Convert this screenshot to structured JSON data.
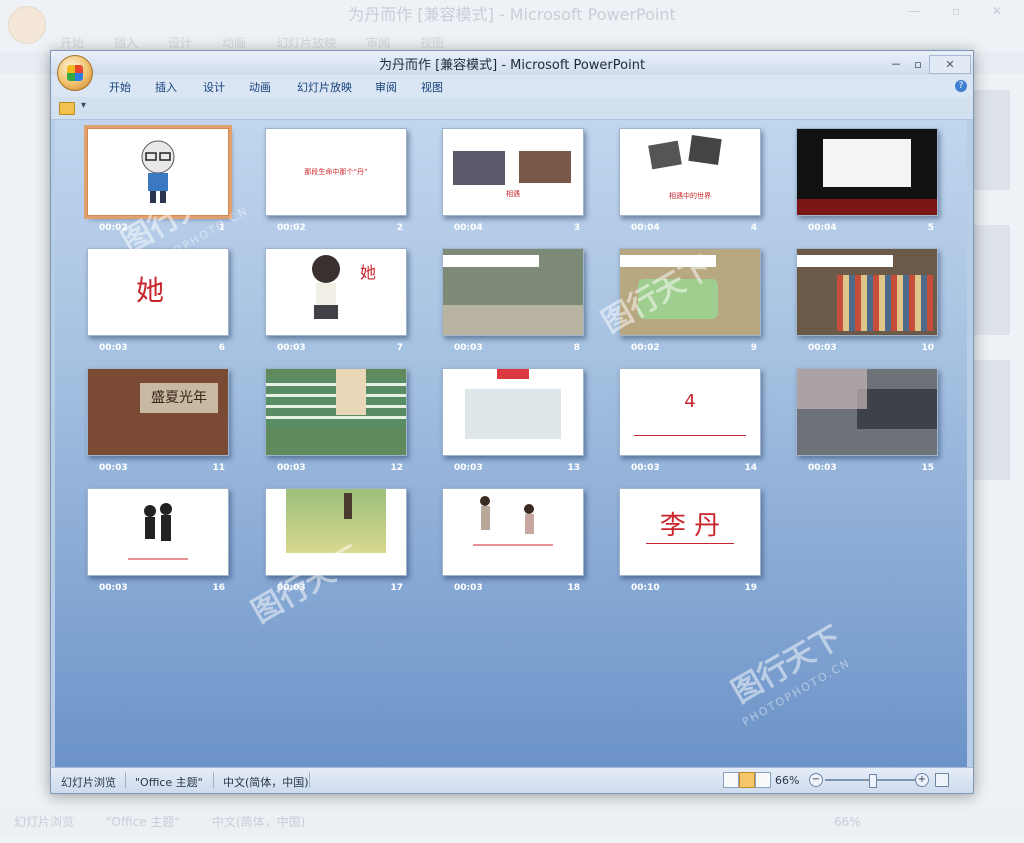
{
  "window": {
    "title": "为丹而作 [兼容模式] - Microsoft PowerPoint",
    "controls": [
      "－",
      "▫",
      "✕"
    ]
  },
  "tabs": [
    "开始",
    "插入",
    "设计",
    "动画",
    "幻灯片放映",
    "审阅",
    "视图"
  ],
  "slides": [
    {
      "number": "1",
      "time": "00:02",
      "text": "",
      "selected": true
    },
    {
      "number": "2",
      "time": "00:02",
      "text": "那段生命中那个“丹”",
      "selected": false
    },
    {
      "number": "3",
      "time": "00:04",
      "text": "相遇",
      "selected": false
    },
    {
      "number": "4",
      "time": "00:04",
      "text": "相遇中的世界",
      "selected": false
    },
    {
      "number": "5",
      "time": "00:04",
      "text": "",
      "selected": false
    },
    {
      "number": "6",
      "time": "00:03",
      "text": "她",
      "selected": false
    },
    {
      "number": "7",
      "time": "00:03",
      "text": "她",
      "selected": false
    },
    {
      "number": "8",
      "time": "00:03",
      "text": "",
      "selected": false
    },
    {
      "number": "9",
      "time": "00:02",
      "text": "",
      "selected": false
    },
    {
      "number": "10",
      "time": "00:03",
      "text": "",
      "selected": false
    },
    {
      "number": "11",
      "time": "00:03",
      "text": "盛夏光年",
      "selected": false
    },
    {
      "number": "12",
      "time": "00:03",
      "text": "",
      "selected": false
    },
    {
      "number": "13",
      "time": "00:03",
      "text": "",
      "selected": false
    },
    {
      "number": "14",
      "time": "00:03",
      "text": "4",
      "selected": false
    },
    {
      "number": "15",
      "time": "00:03",
      "text": "",
      "selected": false
    },
    {
      "number": "16",
      "time": "00:03",
      "text": "",
      "selected": false
    },
    {
      "number": "17",
      "time": "00:03",
      "text": "",
      "selected": false
    },
    {
      "number": "18",
      "time": "00:03",
      "text": "",
      "selected": false
    },
    {
      "number": "19",
      "time": "00:10",
      "text": "李 丹",
      "selected": false
    }
  ],
  "status": {
    "view": "幻灯片浏览",
    "theme": "\"Office 主题\"",
    "language": "中文(简体，中国)",
    "zoom": "66%"
  },
  "background": {
    "title": "为丹而作 [兼容模式] - Microsoft PowerPoint",
    "status_view": "幻灯片浏览",
    "status_theme": "\"Office 主题\"",
    "status_language": "中文(简体，中国)",
    "status_zoom": "66%"
  },
  "watermark": {
    "text": "图行天下",
    "url": "PHOTOPHOTO.CN"
  },
  "colors": {
    "accent": "#c8262c",
    "sorter_bg": "#8fb0d8"
  }
}
